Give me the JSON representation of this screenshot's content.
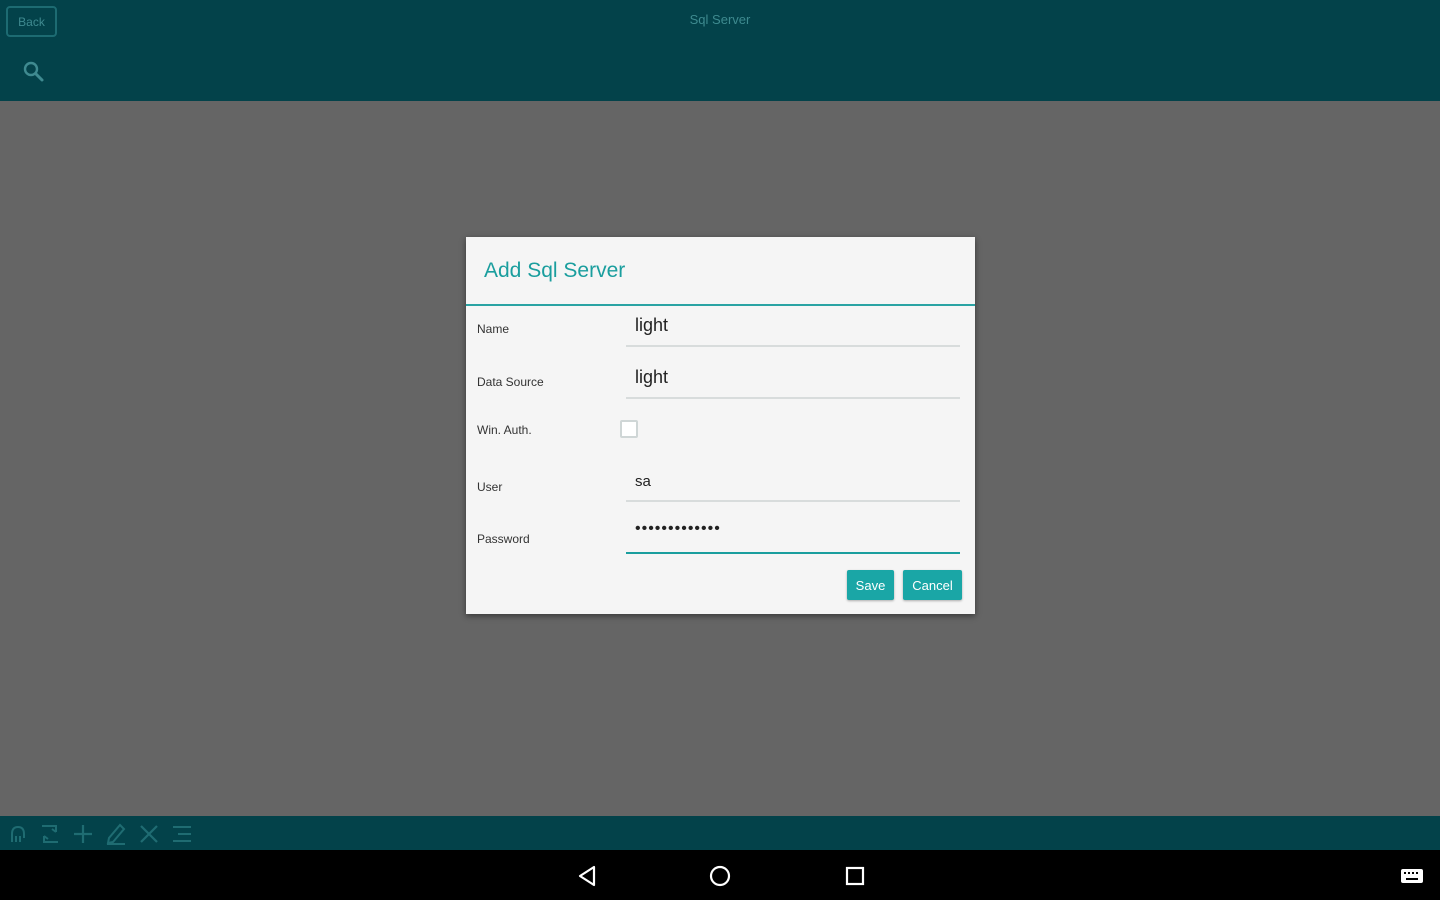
{
  "app": {
    "back_label": "Back",
    "title": "Sql Server"
  },
  "dialog": {
    "title": "Add Sql Server",
    "fields": {
      "name": {
        "label": "Name",
        "value": "light"
      },
      "data_source": {
        "label": "Data Source",
        "value": "light"
      },
      "win_auth": {
        "label": "Win. Auth.",
        "checked": false
      },
      "user": {
        "label": "User",
        "value": "sa"
      },
      "password": {
        "label": "Password",
        "value": "•••••••••••••"
      }
    },
    "buttons": {
      "save": "Save",
      "cancel": "Cancel"
    }
  },
  "bottom_toolbar": {
    "icons": [
      "connect-icon",
      "refresh-icon",
      "add-icon",
      "edit-icon",
      "delete-icon",
      "list-icon"
    ]
  },
  "nav": {
    "icons": [
      "back-triangle-icon",
      "home-circle-icon",
      "recents-square-icon",
      "keyboard-icon"
    ]
  },
  "colors": {
    "app_bar": "#03424a",
    "accent": "#1aa6a6",
    "dialog_bg": "#f5f5f5",
    "scrim": "#656565"
  }
}
